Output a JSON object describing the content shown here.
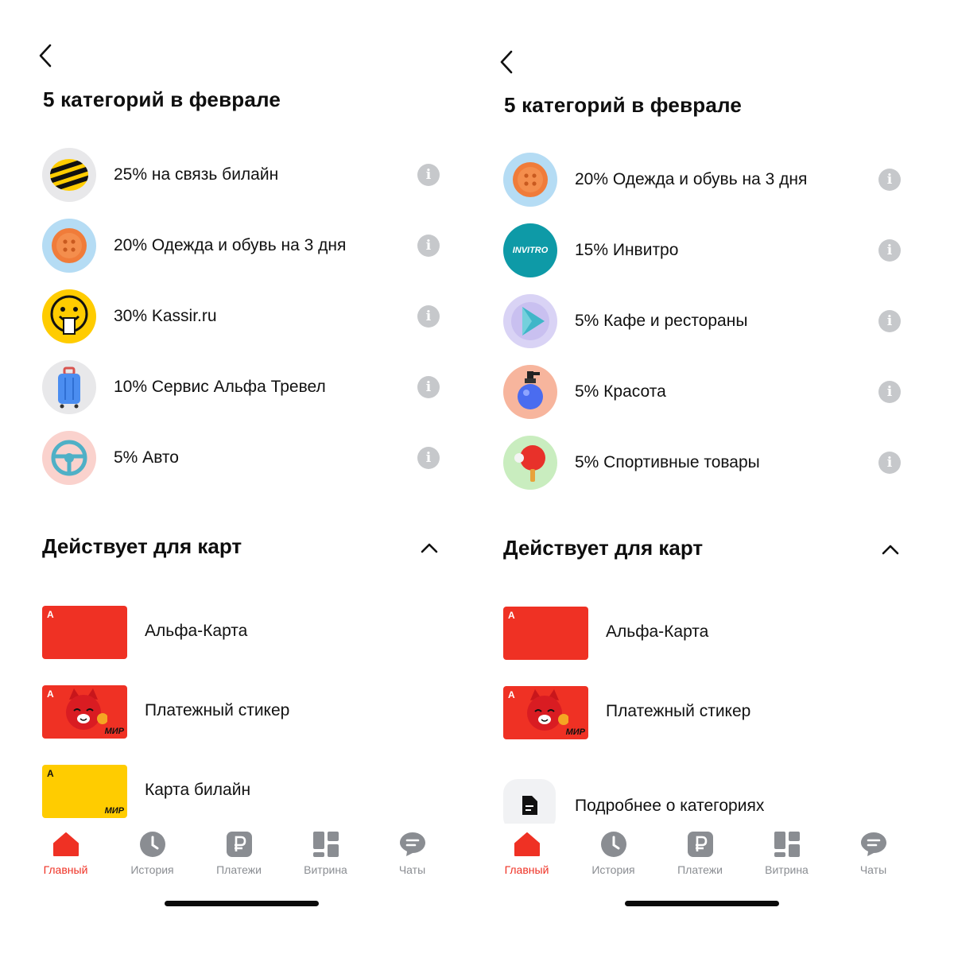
{
  "left": {
    "title": "5 категорий в феврале",
    "categories": [
      {
        "label": "25% на связь билайн",
        "icon": "beeline-icon"
      },
      {
        "label": "20% Одежда и обувь на 3 дня",
        "icon": "button-clothing-icon"
      },
      {
        "label": "30% Kassir.ru",
        "icon": "smiley-ticket-icon"
      },
      {
        "label": "10% Сервис Альфа Тревел",
        "icon": "suitcase-icon"
      },
      {
        "label": "5% Авто",
        "icon": "steering-wheel-icon"
      }
    ],
    "cards_title": "Действует для карт",
    "cards": [
      {
        "label": "Альфа-Карта",
        "logo": "А",
        "payment": ""
      },
      {
        "label": "Платежный стикер",
        "logo": "А",
        "payment": "МИР"
      },
      {
        "label": "Карта билайн",
        "logo": "А",
        "payment": "МИР"
      }
    ]
  },
  "right": {
    "title": "5 категорий в феврале",
    "categories": [
      {
        "label": "20% Одежда и обувь на 3 дня",
        "icon": "button-clothing-icon"
      },
      {
        "label": "15% Инвитро",
        "icon": "invitro-icon",
        "icon_text": "INVITRO"
      },
      {
        "label": "5% Кафе и рестораны",
        "icon": "play-cafe-icon"
      },
      {
        "label": "5% Красота",
        "icon": "perfume-bottle-icon"
      },
      {
        "label": "5% Спортивные товары",
        "icon": "ping-pong-icon"
      }
    ],
    "cards_title": "Действует для карт",
    "cards": [
      {
        "label": "Альфа-Карта",
        "logo": "А",
        "payment": ""
      },
      {
        "label": "Платежный стикер",
        "logo": "А",
        "payment": "МИР"
      }
    ],
    "more_label": "Подробнее о категориях"
  },
  "tabbar": {
    "tabs": [
      {
        "label": "Главный",
        "icon": "home-icon",
        "active": true
      },
      {
        "label": "История",
        "icon": "clock-icon",
        "active": false
      },
      {
        "label": "Платежи",
        "icon": "ruble-icon",
        "active": false
      },
      {
        "label": "Витрина",
        "icon": "showcase-grid-icon",
        "active": false
      },
      {
        "label": "Чаты",
        "icon": "chat-bubble-icon",
        "active": false
      }
    ]
  },
  "colors": {
    "brand_red": "#ef3124",
    "tab_inactive": "#8a8d92",
    "info_gray": "#c6c8cb",
    "beeline_yellow": "#ffcc00"
  }
}
